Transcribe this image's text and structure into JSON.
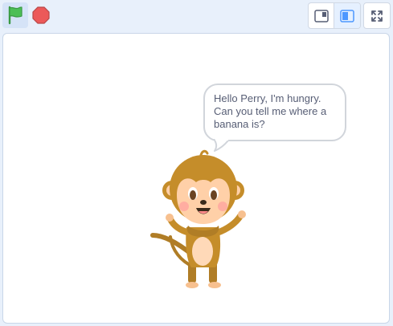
{
  "toolbar": {
    "icons": {
      "green_flag": "green-flag-icon",
      "stop": "stop-sign-icon",
      "small_stage": "small-stage-icon",
      "large_stage": "large-stage-icon",
      "fullscreen": "fullscreen-icon"
    }
  },
  "stage": {
    "sprite": "monkey",
    "speech_bubble": {
      "lines": [
        "Hello Perry, I'm hungry.",
        "Can you tell me where a",
        "banana is?"
      ]
    }
  },
  "colors": {
    "accent": "#4c97ff",
    "flag_green": "#4cbf56",
    "stop_red": "#ec5959",
    "monkey_brown": "#c58d2a",
    "monkey_face": "#ffd0a8"
  }
}
